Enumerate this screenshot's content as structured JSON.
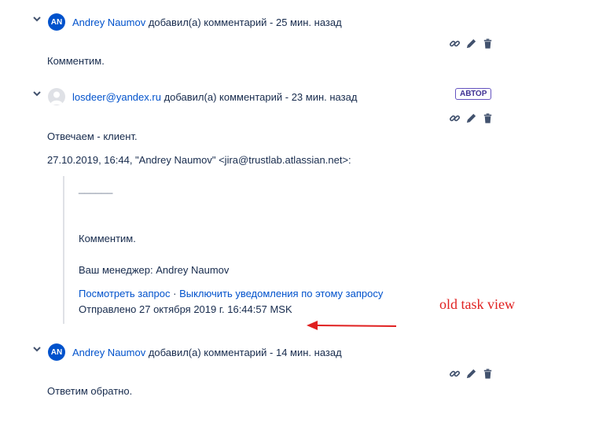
{
  "comments": [
    {
      "avatar_initials": "AN",
      "author": "Andrey Naumov",
      "action_text": "добавил(а) комментарий - 25 мин. назад",
      "body": "Комментим."
    },
    {
      "author": "losdeer@yandex.ru",
      "action_text": "добавил(а) комментарий - 23 мин. назад",
      "badge": "АВТОР",
      "body_lines": [
        "Отвечаем - клиент.",
        "27.10.2019, 16:44, \"Andrey Naumov\" <jira@trustlab.atlassian.net>:"
      ],
      "quote": {
        "separator": "______",
        "text": "Комментим.",
        "manager_line": "Ваш менеджер: Andrey Naumov",
        "view_link": "Посмотреть запрос",
        "link_separator": "·",
        "unsubscribe_link": "Выключить уведомления по этому запросу",
        "sent_line": "Отправлено 27 октября 2019 г. 16:44:57 MSK"
      }
    },
    {
      "avatar_initials": "AN",
      "author": "Andrey Naumov",
      "action_text": "добавил(а) комментарий - 14 мин. назад",
      "body": "Ответим обратно."
    }
  ],
  "annotation": {
    "text": "old task view",
    "color": "#e02020"
  },
  "colors": {
    "link": "#0052cc",
    "avatar": "#0052cc",
    "text": "#172b4d",
    "badge": "#6554c0"
  },
  "icons": [
    "chevron-down-icon",
    "link-icon",
    "pencil-icon",
    "trash-icon",
    "user-placeholder-icon"
  ]
}
